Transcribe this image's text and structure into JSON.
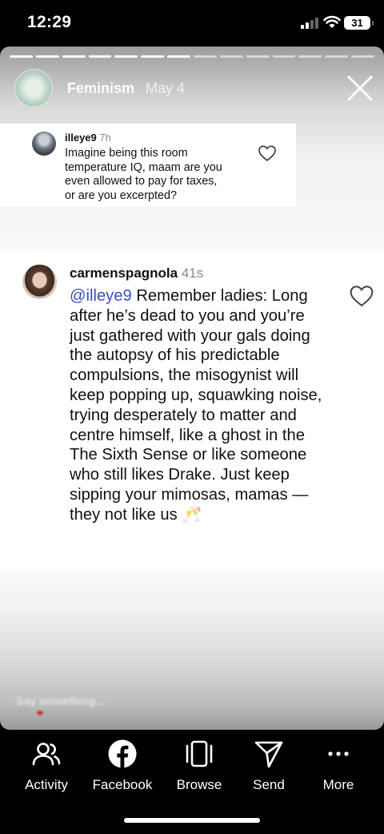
{
  "status_bar": {
    "time": "12:29",
    "battery": "31",
    "cellular_icon": "signal-bars-icon",
    "wifi_icon": "wifi-icon"
  },
  "story": {
    "account_name": "Feminism",
    "date": "May 4",
    "close_icon": "close-icon",
    "progress_segments": 14,
    "progress_completed": 7
  },
  "comment_1": {
    "username": "illeye9",
    "time": "7h",
    "text": "Imagine being this room\ntemperature IQ, maam are you\neven allowed to pay for taxes,\nor are you excerpted?",
    "like_icon": "heart-outline-icon"
  },
  "comment_2": {
    "username": "carmenspagnola",
    "time": "41s",
    "mention": "@illeye9",
    "text": " Remember ladies: Long after he’s dead to you and you’re just gathered with your gals doing the autopsy of his predictable compulsions, the misogynist will keep popping up, squawking noise, trying desperately to matter and centre himself, like a ghost in the The Sixth Sense or like someone who still likes Drake. Just keep sipping your mimosas, mamas — they not like us 🥂",
    "like_icon": "heart-outline-icon"
  },
  "composer": {
    "placeholder": "Say something..."
  },
  "bottom_nav": [
    {
      "label": "Activity",
      "icon": "people-icon"
    },
    {
      "label": "Facebook",
      "icon": "facebook-icon"
    },
    {
      "label": "Browse",
      "icon": "cards-icon"
    },
    {
      "label": "Send",
      "icon": "paper-plane-icon"
    },
    {
      "label": "More",
      "icon": "more-dots-icon"
    }
  ],
  "colors": {
    "mention": "#3b4ec4",
    "status_bar_bg": "#000000"
  }
}
